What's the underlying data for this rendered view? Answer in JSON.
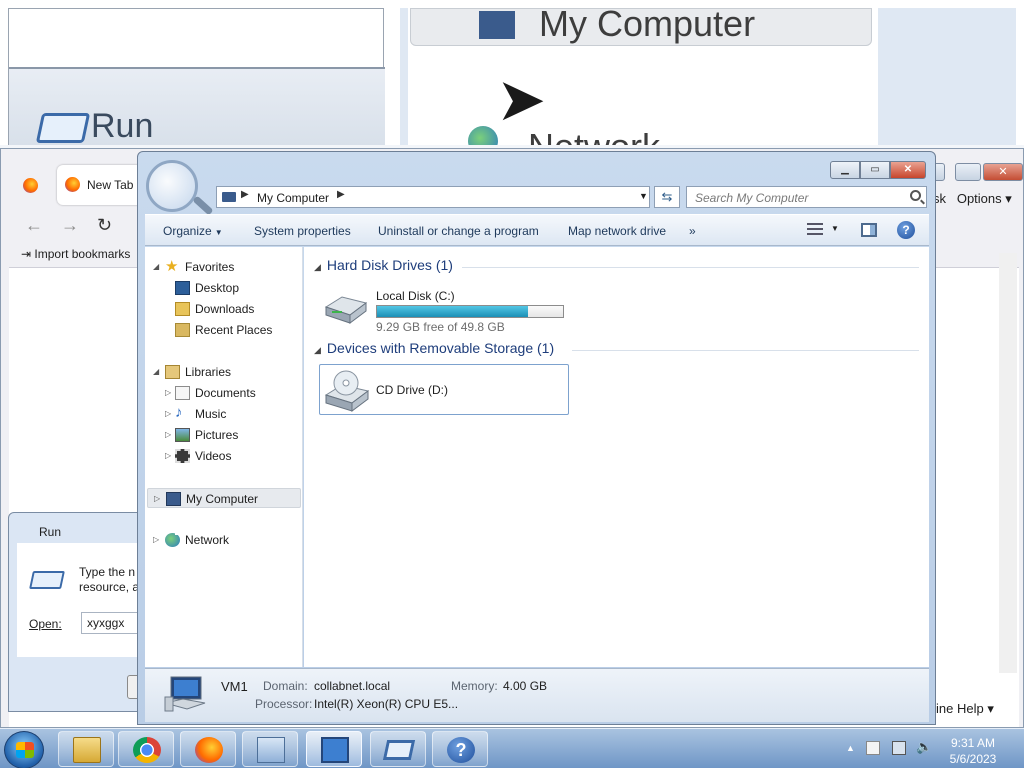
{
  "zoom": {
    "run_title": "Run",
    "computer_label": "My Computer",
    "network_label": "Network"
  },
  "firefox": {
    "tab_label": "New Tab",
    "bookmarks_label": "Import bookmarks",
    "options_label": "Options",
    "options_prefix": "sk",
    "help_label": "ine Help"
  },
  "run": {
    "title": "Run",
    "instruction_line1": "Type the n",
    "instruction_line2": "resource, a",
    "open_label": "Open:",
    "open_value": "xyxggx"
  },
  "explorer": {
    "address_text": "My Computer",
    "search_placeholder": "Search My Computer",
    "toolbar": {
      "organize": "Organize",
      "system_properties": "System properties",
      "uninstall": "Uninstall or change a program",
      "map_drive": "Map network drive",
      "more": "»"
    },
    "nav": {
      "favorites": "Favorites",
      "desktop": "Desktop",
      "downloads": "Downloads",
      "recent_places": "Recent Places",
      "libraries": "Libraries",
      "documents": "Documents",
      "music": "Music",
      "pictures": "Pictures",
      "videos": "Videos",
      "my_computer": "My Computer",
      "network": "Network"
    },
    "groups": {
      "hard_disks": "Hard Disk Drives (1)",
      "removable": "Devices with Removable Storage (1)"
    },
    "local_disk": {
      "name": "Local Disk (C:)",
      "free_text": "9.29 GB free of 49.8 GB",
      "used_fraction": 0.81
    },
    "cd_drive": {
      "name": "CD Drive (D:)"
    },
    "details": {
      "name": "VM1",
      "domain_label": "Domain:",
      "domain_value": "collabnet.local",
      "memory_label": "Memory:",
      "memory_value": "4.00 GB",
      "processor_label": "Processor:",
      "processor_value": "Intel(R) Xeon(R) CPU E5..."
    }
  },
  "taskbar": {
    "time": "9:31 AM",
    "date": "5/6/2023"
  },
  "colors": {
    "accent": "#1e3d7b",
    "progress": "#1c8fb6",
    "taskbar": "#6f96c6"
  }
}
